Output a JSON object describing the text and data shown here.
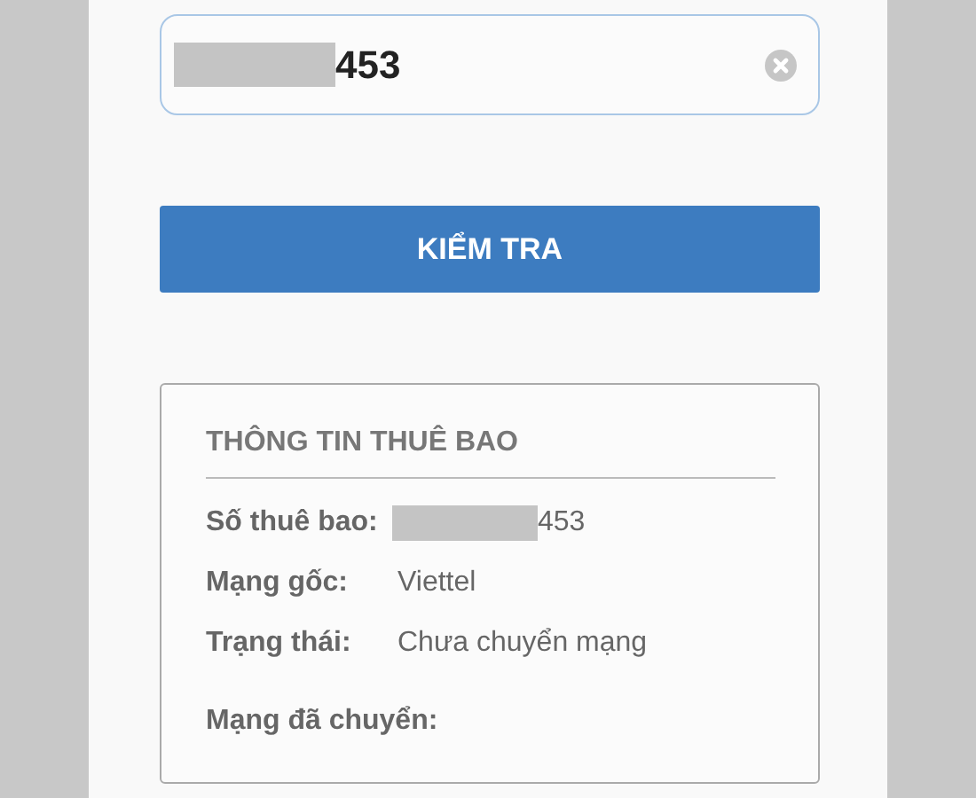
{
  "phone_field": {
    "value": "453",
    "masked": true
  },
  "check_button": {
    "label": "KIỂM TRA"
  },
  "subscriber_info": {
    "title": "THÔNG TIN THUÊ BAO",
    "rows": [
      {
        "label": "Số thuê bao:",
        "value": "453",
        "masked": true
      },
      {
        "label": "Mạng gốc:",
        "value": "Viettel"
      },
      {
        "label": "Trạng thái:",
        "value": "Chưa chuyển mạng"
      },
      {
        "label": "Mạng đã chuyển:"
      }
    ]
  }
}
